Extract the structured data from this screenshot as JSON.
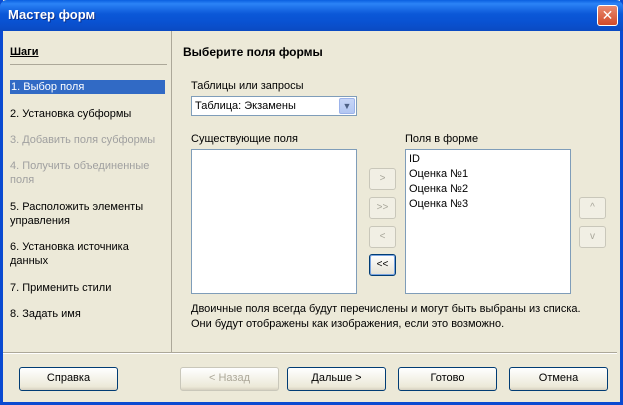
{
  "window": {
    "title": "Мастер форм",
    "close_glyph": "✕"
  },
  "steps": {
    "header": "Шаги",
    "items": [
      {
        "label": "1. Выбор поля",
        "state": "selected"
      },
      {
        "label": "2. Установка субформы",
        "state": "normal"
      },
      {
        "label": "3. Добавить поля субформы",
        "state": "disabled"
      },
      {
        "label": "4. Получить объединенные поля",
        "state": "disabled"
      },
      {
        "label": "5. Расположить элементы управления",
        "state": "normal"
      },
      {
        "label": "6. Установка источника данных",
        "state": "normal"
      },
      {
        "label": "7. Применить стили",
        "state": "normal"
      },
      {
        "label": "8. Задать имя",
        "state": "normal"
      }
    ]
  },
  "main": {
    "heading": "Выберите поля формы",
    "tables_label": "Таблицы или запросы",
    "table_value": "Таблица: Экзамены",
    "existing_label": "Существующие поля",
    "form_fields_label": "Поля в форме",
    "existing_fields": [],
    "form_fields": [
      "ID",
      "Оценка №1",
      "Оценка №2",
      "Оценка №3"
    ],
    "move_buttons": {
      "add_one": ">",
      "add_all": ">>",
      "remove_one": "<",
      "remove_all": "<<"
    },
    "order_buttons": {
      "up": "^",
      "down": "v"
    },
    "info_line1": "Двоичные поля всегда будут перечислены и могут быть выбраны из списка.",
    "info_line2": "Они будут отображены как изображения, если это возможно."
  },
  "footer": {
    "help": "Справка",
    "back": "< Назад",
    "next": "Дальше >",
    "finish": "Готово",
    "cancel": "Отмена"
  }
}
